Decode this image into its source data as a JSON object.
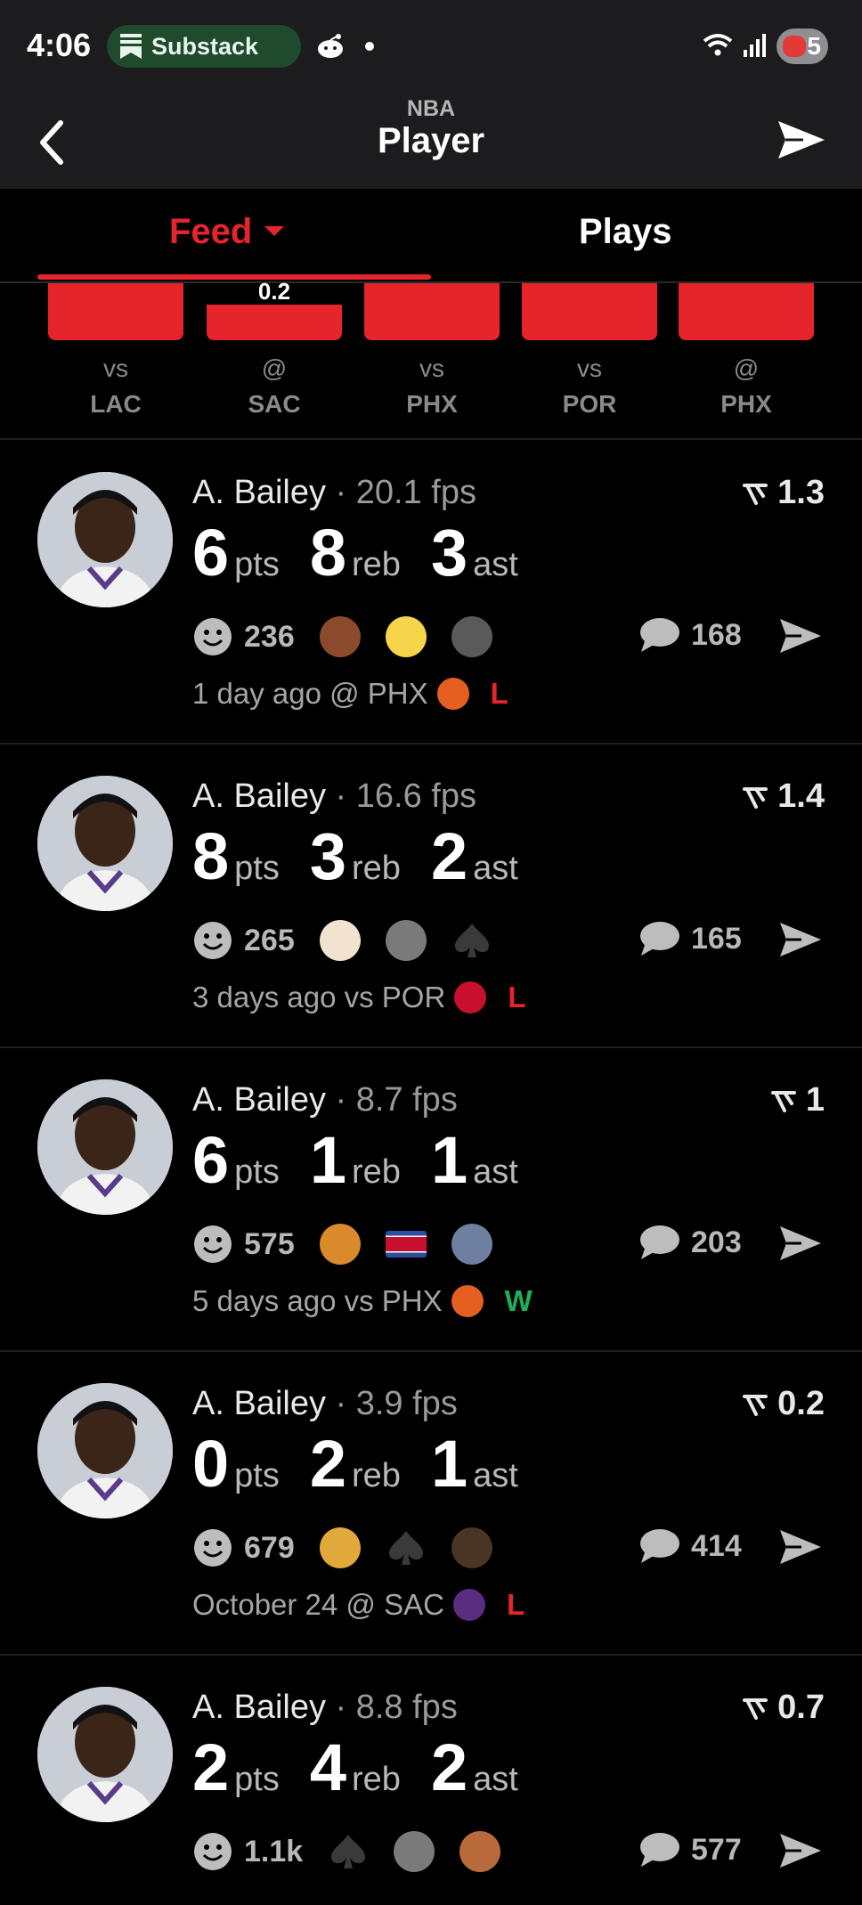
{
  "status_bar": {
    "time": "4:06",
    "notification_app": "Substack",
    "battery_text": "5"
  },
  "header": {
    "league": "NBA",
    "title": "Player"
  },
  "tabs": [
    {
      "label": "Feed",
      "active": true
    },
    {
      "label": "Plays",
      "active": false
    }
  ],
  "games_strip": [
    {
      "loc": "vs",
      "opp": "LAC",
      "bar_value": "",
      "fill": 1.0
    },
    {
      "loc": "@",
      "opp": "SAC",
      "bar_value": "0.2",
      "fill": 0.62
    },
    {
      "loc": "vs",
      "opp": "PHX",
      "bar_value": "",
      "fill": 1.0
    },
    {
      "loc": "vs",
      "opp": "POR",
      "bar_value": "",
      "fill": 1.0
    },
    {
      "loc": "@",
      "opp": "PHX",
      "bar_value": "",
      "fill": 1.0
    }
  ],
  "feed": [
    {
      "player": "A. Bailey",
      "fps": "· 20.1 fps",
      "rating": "1.3",
      "pts": "6",
      "reb": "8",
      "ast": "3",
      "pts_label": "pts",
      "reb_label": "reb",
      "ast_label": "ast",
      "reaction_count": "236",
      "emojis": [
        "poop-emoji",
        "hatching-chick-emoji",
        "basketball-hoop-emoji"
      ],
      "comment_count": "168",
      "when": "1 day ago @ PHX",
      "team_logo": "suns-logo",
      "result": "L"
    },
    {
      "player": "A. Bailey",
      "fps": "· 16.6 fps",
      "rating": "1.4",
      "pts": "8",
      "reb": "3",
      "ast": "2",
      "pts_label": "pts",
      "reb_label": "reb",
      "ast_label": "ast",
      "reaction_count": "265",
      "emojis": [
        "clown-emoji",
        "elderly-walker-emoji",
        "spade-emoji"
      ],
      "comment_count": "165",
      "when": "3 days ago vs POR",
      "team_logo": "blazers-logo",
      "result": "L"
    },
    {
      "player": "A. Bailey",
      "fps": "· 8.7 fps",
      "rating": "1",
      "pts": "6",
      "reb": "1",
      "ast": "1",
      "pts_label": "pts",
      "reb_label": "reb",
      "ast_label": "ast",
      "reaction_count": "575",
      "emojis": [
        "biohazard-emoji",
        "north-korea-flag-emoji",
        "player-photo-emoji"
      ],
      "comment_count": "203",
      "when": "5 days ago vs PHX",
      "team_logo": "suns-logo",
      "result": "W"
    },
    {
      "player": "A. Bailey",
      "fps": "· 3.9 fps",
      "rating": "0.2",
      "pts": "0",
      "reb": "2",
      "ast": "1",
      "pts_label": "pts",
      "reb_label": "reb",
      "ast_label": "ast",
      "reaction_count": "679",
      "emojis": [
        "middle-finger-emoji",
        "spade-emoji",
        "player-face-emoji"
      ],
      "comment_count": "414",
      "when": "October 24 @ SAC",
      "team_logo": "kings-logo",
      "result": "L"
    },
    {
      "player": "A. Bailey",
      "fps": "· 8.8 fps",
      "rating": "0.7",
      "pts": "2",
      "reb": "4",
      "ast": "2",
      "pts_label": "pts",
      "reb_label": "reb",
      "ast_label": "ast",
      "reaction_count": "1.1k",
      "emojis": [
        "spade-emoji",
        "elderly-walker-emoji",
        "laughing-face-emoji"
      ],
      "comment_count": "577",
      "when": "",
      "team_logo": "",
      "result": ""
    }
  ],
  "colors": {
    "accent": "#e5242b",
    "win": "#1fae5b",
    "loss": "#e5242b",
    "background": "#000000",
    "header_bg": "#1c1c1e"
  }
}
